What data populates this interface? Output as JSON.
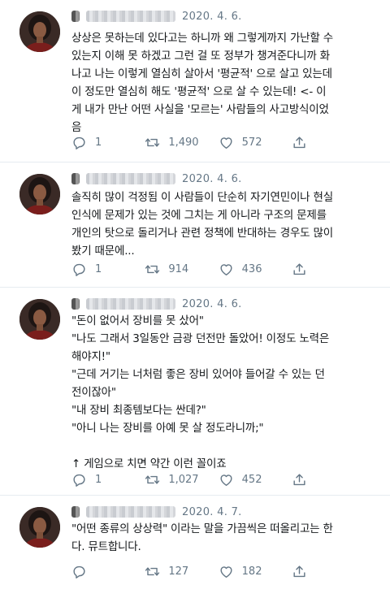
{
  "tweets": [
    {
      "date": "2020. 4. 6.",
      "lines": [
        "상상은 못하는데 있다고는 하니까 왜 그렇게까지 가난할 수",
        "있는지 이해 못 하겠고 그런 걸 또 정부가 챙겨준다니까 화",
        "나고 나는 이렇게 열심히 살아서 '평균적' 으로 살고 있는데",
        "이 정도만 열심히 해도 '평균적' 으로 살 수 있는데! <- 이",
        "게 내가 만난 어떤 사실을 '모르는' 사람들의 사고방식이었",
        "음"
      ],
      "replies": "1",
      "retweets": "1,490",
      "likes": "572"
    },
    {
      "date": "2020. 4. 6.",
      "lines": [
        "솔직히 많이 걱정됨 이 사람들이 단순히 자기연민이나 현실",
        "인식에 문제가 있는 것에 그치는 게 아니라 구조의 문제를",
        "개인의 탓으로 돌리거나 관련 정책에 반대하는 경우도 많이",
        "봤기 때문에..."
      ],
      "replies": "1",
      "retweets": "914",
      "likes": "436"
    },
    {
      "date": "2020. 4. 6.",
      "lines": [
        "\"돈이 없어서 장비를 못 샀어\"",
        "\"나도 그래서 3일동안 금광 던전만 돌았어! 이정도 노력은",
        "해야지!\"",
        "\"근데 거기는 너처럼 좋은 장비 있어야 들어갈 수 있는 던",
        "전이잖아\"",
        "\"내 장비 최종템보다는 싼데?\"",
        "\"아니 나는 장비를 아예 못 살 정도라니까;\"",
        "",
        "↑ 게임으로 치면 약간 이런 꼴이죠"
      ],
      "replies": "1",
      "retweets": "1,027",
      "likes": "452"
    },
    {
      "date": "2020. 4. 7.",
      "lines": [
        "\"어떤 종류의 상상력\" 이라는 말을 가끔씩은 떠올리고는 한",
        "다. 뮤트합니다."
      ],
      "replies": "",
      "retweets": "127",
      "likes": "182"
    }
  ],
  "icons": {
    "reply": "reply-icon",
    "retweet": "retweet-icon",
    "like": "heart-icon",
    "share": "share-icon"
  },
  "colors": {
    "text": "#14171a",
    "muted": "#657786",
    "divider": "#e6ecf0"
  }
}
